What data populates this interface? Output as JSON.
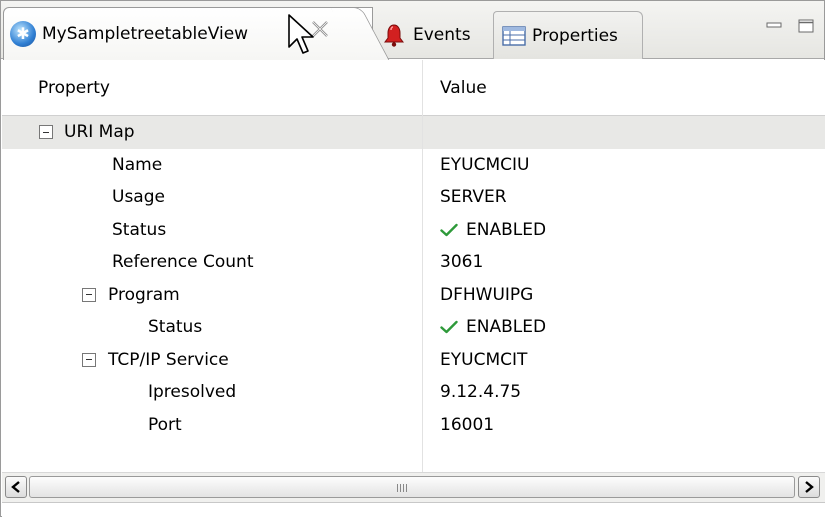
{
  "tabs": {
    "view_label": "MySampletreetableView",
    "events_label": "Events",
    "properties_label": "Properties"
  },
  "columns": {
    "property": "Property",
    "value": "Value"
  },
  "rows": [
    {
      "property": "URI Map",
      "value": "",
      "level": 0,
      "group": true
    },
    {
      "property": "Name",
      "value": "EYUCMCIU",
      "level": 1,
      "group": false
    },
    {
      "property": "Usage",
      "value": "SERVER",
      "level": 1,
      "group": false
    },
    {
      "property": "Status",
      "value": "ENABLED",
      "level": 1,
      "group": false,
      "status_icon": "check-icon"
    },
    {
      "property": "Reference Count",
      "value": "3061",
      "level": 1,
      "group": false
    },
    {
      "property": "Program",
      "value": "DFHWUIPG",
      "level": 1,
      "group": true
    },
    {
      "property": "Status",
      "value": "ENABLED",
      "level": 2,
      "group": false,
      "status_icon": "check-icon"
    },
    {
      "property": "TCP/IP Service",
      "value": "EYUCMCIT",
      "level": 1,
      "group": true
    },
    {
      "property": "Ipresolved",
      "value": "9.12.4.75",
      "level": 2,
      "group": false
    },
    {
      "property": "Port",
      "value": "16001",
      "level": 2,
      "group": false
    }
  ],
  "colors": {
    "check_green": "#2e9a3a",
    "group_row_bg": "#e8e8e6",
    "bell_red": "#d22020"
  }
}
